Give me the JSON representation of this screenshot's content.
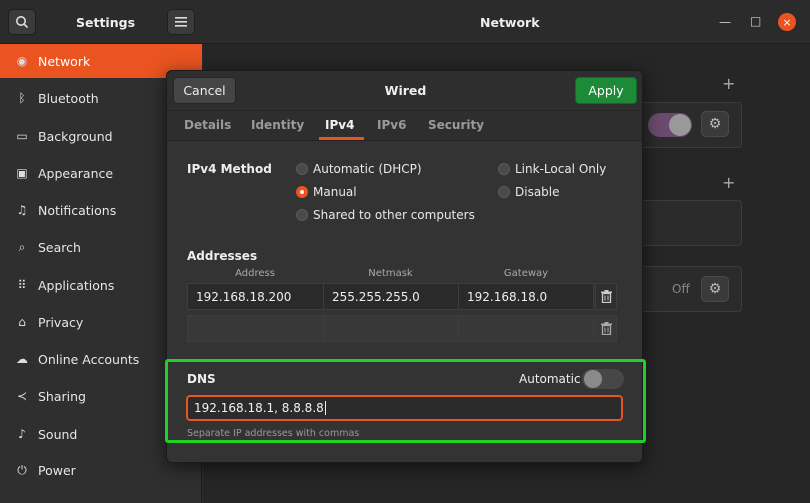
{
  "window": {
    "settings_title": "Settings",
    "panel_title": "Network",
    "minimize": "—",
    "maximize": "□",
    "close": "×"
  },
  "sidebar": {
    "items": [
      {
        "label": "Network",
        "icon": "network-icon",
        "glyph": "◉"
      },
      {
        "label": "Bluetooth",
        "icon": "bluetooth-icon",
        "glyph": "ᛒ"
      },
      {
        "label": "Background",
        "icon": "display-icon",
        "glyph": "▭"
      },
      {
        "label": "Appearance",
        "icon": "appearance-icon",
        "glyph": "▣"
      },
      {
        "label": "Notifications",
        "icon": "bell-icon",
        "glyph": "♫"
      },
      {
        "label": "Search",
        "icon": "search-icon",
        "glyph": "⌕"
      },
      {
        "label": "Applications",
        "icon": "grid-icon",
        "glyph": "⠿"
      },
      {
        "label": "Privacy",
        "icon": "lock-icon",
        "glyph": "⌂"
      },
      {
        "label": "Online Accounts",
        "icon": "cloud-icon",
        "glyph": "☁"
      },
      {
        "label": "Sharing",
        "icon": "share-icon",
        "glyph": "≺"
      },
      {
        "label": "Sound",
        "icon": "music-icon",
        "glyph": "♪"
      },
      {
        "label": "Power",
        "icon": "power-icon",
        "glyph": "⏻"
      }
    ]
  },
  "main": {
    "off_label": "Off",
    "plus": "+"
  },
  "dialog": {
    "title": "Wired",
    "cancel": "Cancel",
    "apply": "Apply",
    "tabs": [
      "Details",
      "Identity",
      "IPv4",
      "IPv6",
      "Security"
    ],
    "active_tab": "IPv4",
    "ipv4_method_label": "IPv4 Method",
    "methods": {
      "automatic": "Automatic (DHCP)",
      "manual": "Manual",
      "shared": "Shared to other computers",
      "link_local": "Link-Local Only",
      "disable": "Disable"
    },
    "selected_method": "Manual",
    "addresses_label": "Addresses",
    "columns": [
      "Address",
      "Netmask",
      "Gateway"
    ],
    "rows": [
      {
        "address": "192.168.18.200",
        "netmask": "255.255.255.0",
        "gateway": "192.168.18.0"
      },
      {
        "address": "",
        "netmask": "",
        "gateway": ""
      }
    ],
    "dns_label": "DNS",
    "dns_automatic_label": "Automatic",
    "dns_automatic_on": false,
    "dns_value": "192.168.18.1, 8.8.8.8",
    "dns_helper": "Separate IP addresses with commas"
  },
  "colors": {
    "accent": "#e95420",
    "apply_green": "#1d8a37",
    "highlight_green": "#22d024"
  }
}
